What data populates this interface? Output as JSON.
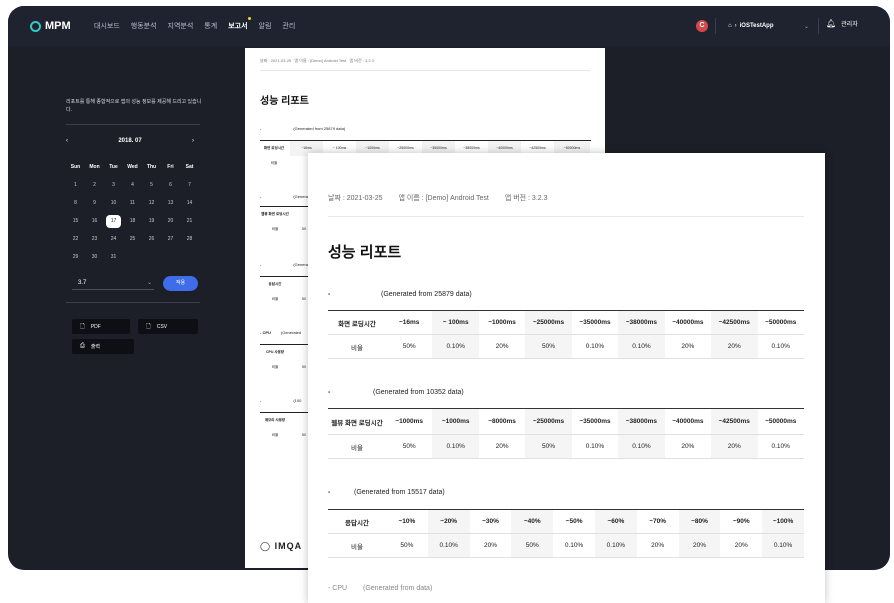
{
  "app": {
    "logo": "MPM",
    "nav": [
      "대시보드",
      "행동분석",
      "지역분석",
      "통계",
      "보고서",
      "알림",
      "관리"
    ],
    "active_nav": "보고서",
    "avatar_letter": "C",
    "app_selector": "iOSTestApp",
    "admin": "관리자"
  },
  "sidebar": {
    "description": "리포트를 통해 종합적으로 앱의 성능 정보를 제공해 드리고 있습니다.",
    "calendar": {
      "month": "2018. 07",
      "dow": [
        "Sun",
        "Mon",
        "Tue",
        "Wed",
        "Thu",
        "Fri",
        "Sat"
      ],
      "weeks": [
        [
          "1",
          "2",
          "3",
          "4",
          "5",
          "6",
          "7"
        ],
        [
          "8",
          "9",
          "10",
          "11",
          "12",
          "13",
          "14"
        ],
        [
          "15",
          "16",
          "17",
          "18",
          "19",
          "20",
          "21"
        ],
        [
          "22",
          "23",
          "24",
          "25",
          "26",
          "27",
          "28"
        ],
        [
          "29",
          "30",
          "31",
          "",
          "",
          "",
          ""
        ]
      ],
      "selected": "17"
    },
    "version": "3.7",
    "apply_label": "적용",
    "pdf_label": "PDF",
    "csv_label": "CSV",
    "print_label": "출력"
  },
  "report": {
    "meta_date": "날짜 : 2021-03-25",
    "meta_app": "앱 이름 : [Demo] Android Test",
    "meta_version": "앱 버전 : 3.2.3",
    "title": "성능 리포트",
    "tables": [
      {
        "dash": "-",
        "generated": "(Generated from 25879 data)",
        "header": "화면 로딩시간",
        "cols": [
          "~16ms",
          "~ 100ms",
          "~1000ms",
          "~25000ms",
          "~35000ms",
          "~38000ms",
          "~40000ms",
          "~42500ms",
          "~50000ms"
        ],
        "row_label": "비율",
        "values": [
          "50%",
          "0.10%",
          "20%",
          "50%",
          "0.10%",
          "0.10%",
          "20%",
          "20%",
          "0.10%"
        ]
      },
      {
        "dash": "-",
        "generated": "(Generated from 10352 data)",
        "header": "웹뷰 화면 로딩시간",
        "cols": [
          "~1000ms",
          "~1000ms",
          "~8000ms",
          "~25000ms",
          "~35000ms",
          "~38000ms",
          "~40000ms",
          "~42500ms",
          "~50000ms"
        ],
        "row_label": "비율",
        "values": [
          "50%",
          "0.10%",
          "20%",
          "50%",
          "0.10%",
          "0.10%",
          "20%",
          "20%",
          "0.10%"
        ]
      },
      {
        "dash": "-",
        "generated": "(Generated from 15517 data)",
        "header": "응답시간",
        "cols": [
          "~10%",
          "~20%",
          "~30%",
          "~40%",
          "~50%",
          "~60%",
          "~70%",
          "~80%",
          "~90%",
          "~100%"
        ],
        "row_label": "비율",
        "values": [
          "50%",
          "0.10%",
          "20%",
          "50%",
          "0.10%",
          "0.10%",
          "20%",
          "20%",
          "20%",
          "0.10%"
        ]
      }
    ],
    "cpu_label": "- CPU",
    "cpu_generated": "(Generated from data)",
    "back_sections": [
      {
        "dash": "-",
        "generated": "(Generated from 25879 data)",
        "header": "화면 로딩시간",
        "cols": [
          "~16ms",
          "~ 100ms",
          "~1000ms",
          "~25000ms",
          "~35000ms",
          "~38000ms",
          "~40000ms",
          "~42500ms",
          "~50000ms"
        ]
      },
      {
        "dash": "-",
        "generated": "(Generate",
        "header": "웹뷰 화면 로딩시간"
      },
      {
        "dash": "-",
        "generated": "(Generated fro",
        "header": "응답시간"
      },
      {
        "dash": "- CPU",
        "generated": "(Generated",
        "header": "CPU 사용량"
      },
      {
        "dash": "-",
        "generated": "(100",
        "header": "메모리 사용량"
      }
    ],
    "back_row_label": "비율",
    "back_first_value": "50",
    "footer_logo": "IMQA"
  }
}
